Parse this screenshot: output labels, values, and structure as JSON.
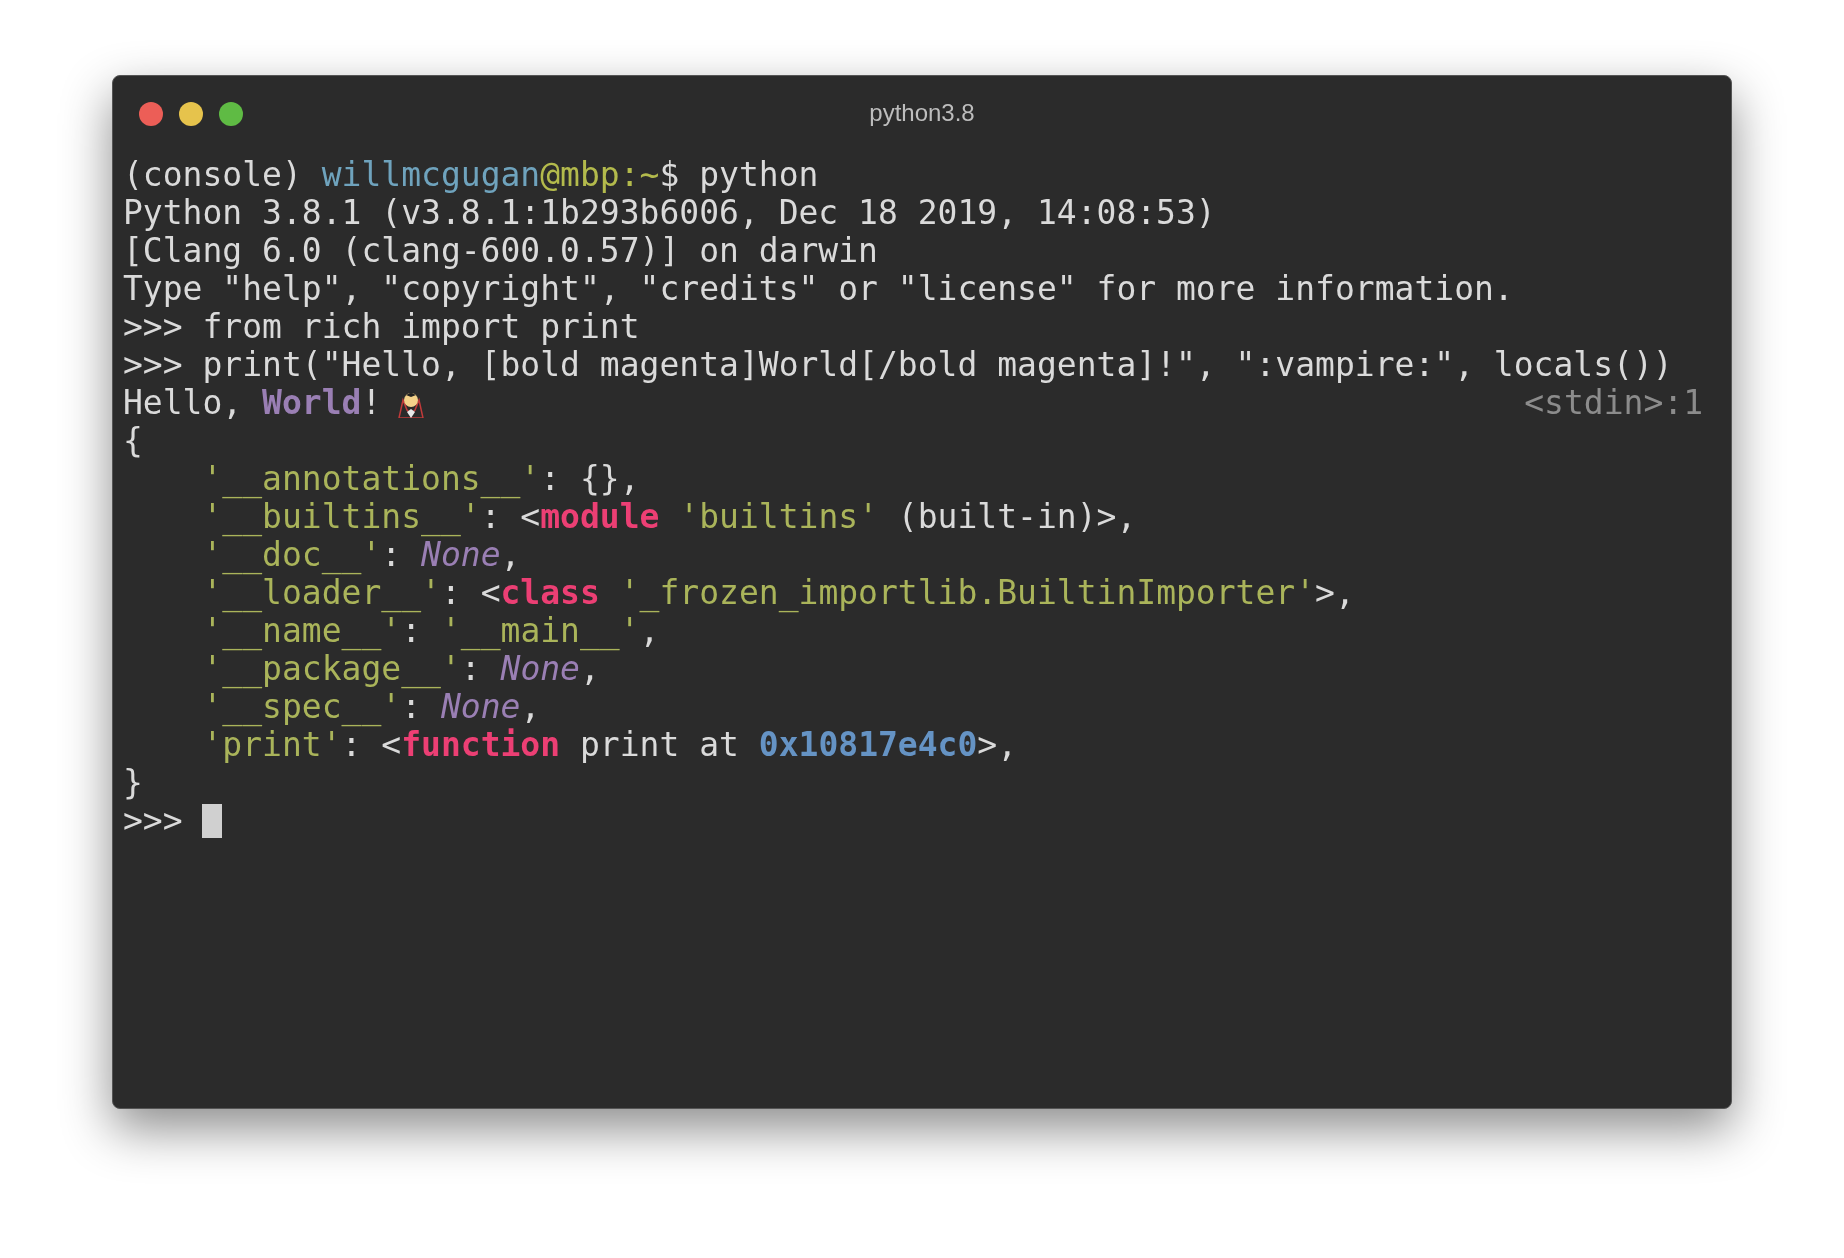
{
  "window": {
    "title": "python3.8"
  },
  "lines": [
    {
      "kind": "text",
      "segments": [
        {
          "text": "(console) ",
          "kind": "plain"
        },
        {
          "text": "willmcgugan",
          "kind": "user"
        },
        {
          "text": "@mbp:~",
          "kind": "host"
        },
        {
          "text": "$ python",
          "kind": "plain"
        }
      ]
    },
    {
      "kind": "text",
      "segments": [
        {
          "text": "Python 3.8.1 (v3.8.1:1b293b6006, Dec 18 2019, 14:08:53)",
          "kind": "plain"
        }
      ]
    },
    {
      "kind": "text",
      "segments": [
        {
          "text": "[Clang 6.0 (clang-600.0.57)] on darwin",
          "kind": "plain"
        }
      ]
    },
    {
      "kind": "text",
      "segments": [
        {
          "text": "Type \"help\", \"copyright\", \"credits\" or \"license\" for more information.",
          "kind": "plain"
        }
      ]
    },
    {
      "kind": "text",
      "segments": [
        {
          "text": ">>> from rich import print",
          "kind": "plain"
        }
      ]
    },
    {
      "kind": "text",
      "segments": [
        {
          "text": ">>> print(\"Hello, [bold magenta]World[/bold magenta]!\", \":vampire:\", locals())",
          "kind": "plain"
        }
      ]
    },
    {
      "kind": "output",
      "segments": [
        {
          "text": "Hello, ",
          "kind": "plain"
        },
        {
          "text": "World",
          "kind": "magenta"
        },
        {
          "text": "!",
          "kind": "plain"
        }
      ],
      "source": "<stdin>:1"
    },
    {
      "kind": "text",
      "segments": [
        {
          "text": "{",
          "kind": "plain"
        }
      ]
    },
    {
      "kind": "text",
      "segments": [
        {
          "text": "    '__annotations__'",
          "kind": "str"
        },
        {
          "text": ": {},",
          "kind": "plain"
        }
      ]
    },
    {
      "kind": "text",
      "segments": [
        {
          "text": "    '__builtins__'",
          "kind": "str"
        },
        {
          "text": ": <",
          "kind": "plain"
        },
        {
          "text": "module",
          "kind": "keyword"
        },
        {
          "text": " 'builtins'",
          "kind": "str"
        },
        {
          "text": " (built-in)>,",
          "kind": "plain"
        }
      ]
    },
    {
      "kind": "text",
      "segments": [
        {
          "text": "    '__doc__'",
          "kind": "str"
        },
        {
          "text": ": ",
          "kind": "plain"
        },
        {
          "text": "None",
          "kind": "none"
        },
        {
          "text": ",",
          "kind": "plain"
        }
      ]
    },
    {
      "kind": "text",
      "segments": [
        {
          "text": "    '__loader__'",
          "kind": "str"
        },
        {
          "text": ": <",
          "kind": "plain"
        },
        {
          "text": "class",
          "kind": "keyword"
        },
        {
          "text": " '_frozen_importlib.BuiltinImporter'",
          "kind": "str"
        },
        {
          "text": ">,",
          "kind": "plain"
        }
      ]
    },
    {
      "kind": "text",
      "segments": [
        {
          "text": "    '__name__'",
          "kind": "str"
        },
        {
          "text": ": ",
          "kind": "plain"
        },
        {
          "text": "'__main__'",
          "kind": "str"
        },
        {
          "text": ",",
          "kind": "plain"
        }
      ]
    },
    {
      "kind": "text",
      "segments": [
        {
          "text": "    '__package__'",
          "kind": "str"
        },
        {
          "text": ": ",
          "kind": "plain"
        },
        {
          "text": "None",
          "kind": "none"
        },
        {
          "text": ",",
          "kind": "plain"
        }
      ]
    },
    {
      "kind": "text",
      "segments": [
        {
          "text": "    '__spec__'",
          "kind": "str"
        },
        {
          "text": ": ",
          "kind": "plain"
        },
        {
          "text": "None",
          "kind": "none"
        },
        {
          "text": ",",
          "kind": "plain"
        }
      ]
    },
    {
      "kind": "text",
      "segments": [
        {
          "text": "    'print'",
          "kind": "str"
        },
        {
          "text": ": <",
          "kind": "plain"
        },
        {
          "text": "function",
          "kind": "keyword"
        },
        {
          "text": " print at ",
          "kind": "plain"
        },
        {
          "text": "0x10817e4c0",
          "kind": "number"
        },
        {
          "text": ">,",
          "kind": "plain"
        }
      ]
    },
    {
      "kind": "text",
      "segments": [
        {
          "text": "}",
          "kind": "plain"
        }
      ]
    },
    {
      "kind": "prompt",
      "segments": [
        {
          "text": ">>> ",
          "kind": "plain"
        }
      ]
    }
  ]
}
